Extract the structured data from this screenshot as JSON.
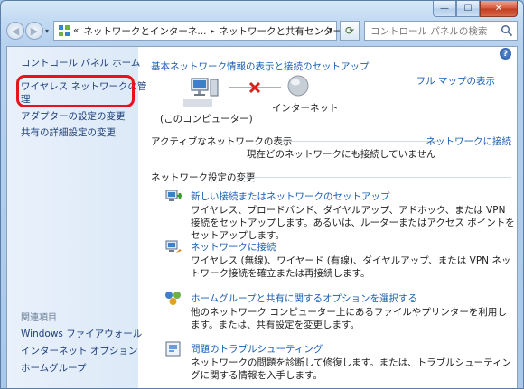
{
  "window": {
    "minimize_label": "—",
    "maximize_label": "☐",
    "close_label": "✕"
  },
  "nav": {
    "back_glyph": "◀",
    "forward_glyph": "▶",
    "breadcrumb_prefix": "«",
    "breadcrumbs": [
      "ネットワークとインターネ...",
      "ネットワークと共有センター"
    ],
    "separator": "▸",
    "search_placeholder": "コントロール パネルの検索"
  },
  "sidebar": {
    "home": "コントロール パネル ホーム",
    "items": [
      "ワイヤレス ネットワークの管理",
      "アダプターの設定の変更",
      "共有の詳細設定の変更"
    ],
    "manage_wireless_line1": "ワイヤレス ネットワークの管",
    "manage_wireless_line2": "理",
    "related_heading": "関連項目",
    "related": [
      "Windows ファイアウォール",
      "インターネット オプション",
      "ホームグループ"
    ]
  },
  "main": {
    "help_label": "?",
    "basic_heading": "基本ネットワーク情報の表示と接続のセットアップ",
    "full_map_link": "フル マップの表示",
    "computer_label": "(このコンピューター)",
    "internet_label": "インターネット",
    "active_heading": "アクティブなネットワークの表示",
    "connect_link": "ネットワークに接続",
    "no_network_text": "現在どのネットワークにも接続していません",
    "settings_heading": "ネットワーク設定の変更",
    "tasks": [
      {
        "title": "新しい接続またはネットワークのセットアップ",
        "desc": "ワイヤレス、ブロードバンド、ダイヤルアップ、アドホック、または VPN 接続をセットアップします。あるいは、ルーターまたはアクセス ポイントをセットアップします。",
        "icon": "network-setup-icon"
      },
      {
        "title": "ネットワークに接続",
        "desc": "ワイヤレス (無線)、ワイヤード (有線)、ダイヤルアップ、または VPN ネットワーク接続を確立または再接続します。",
        "icon": "network-connect-icon"
      },
      {
        "title": "ホームグループと共有に関するオプションを選択する",
        "desc": "他のネットワーク コンピューター上にあるファイルやプリンターを利用します。または、共有設定を変更します。",
        "icon": "homegroup-icon"
      },
      {
        "title": "問題のトラブルシューティング",
        "desc": "ネットワークの問題を診断して修復します。または、トラブルシューティングに関する情報を入手します。",
        "icon": "troubleshoot-icon"
      }
    ]
  },
  "colors": {
    "link": "#1a5fb4",
    "highlight": "#e8121a",
    "sidebar_bg": "#e3eef9"
  }
}
